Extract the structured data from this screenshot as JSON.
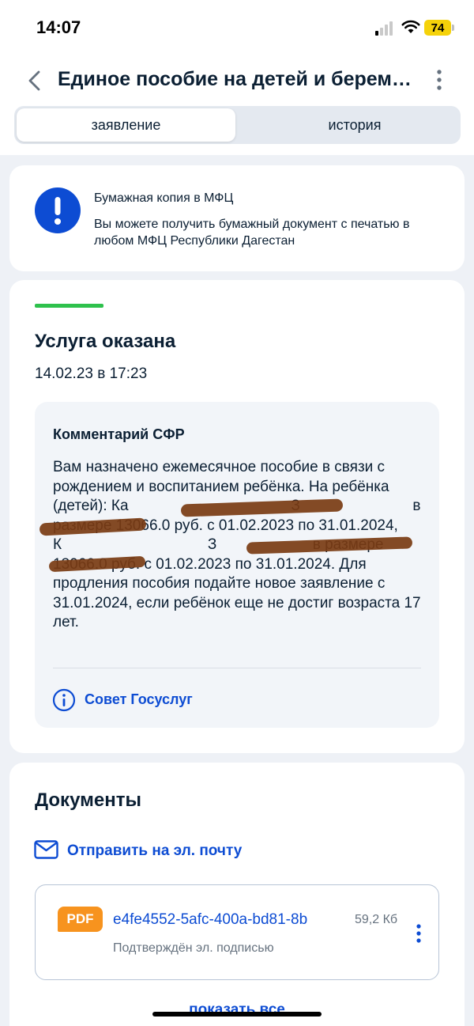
{
  "status_bar": {
    "time": "14:07",
    "battery": "74",
    "battery_color": "#f5d20a"
  },
  "header": {
    "back_icon": "chevron-left-icon",
    "title": "Единое пособие на детей и беременных",
    "more_icon": "vertical-dots-icon"
  },
  "tabs": [
    {
      "label": "заявление",
      "active": true
    },
    {
      "label": "история",
      "active": false
    }
  ],
  "info_card": {
    "icon": "exclamation-icon",
    "title": "Бумажная копия в МФЦ",
    "body": "Вы можете получить бумажный документ с печатью в любом МФЦ Республики Дагестан"
  },
  "status_card": {
    "progress_color": "#2ec14c",
    "title": "Услуга оказана",
    "date": "14.02.23 в 17:23",
    "comment": {
      "title": "Комментарий СФР",
      "text": "Вам назначено ежемесячное пособие в связи с рождением и воспитанием ребёнка. На ребёнка (детей): Ка                                       З                           в размере 13066.0 руб. с 01.02.2023 по 31.01.2024, К                                   З                       в размере 13066.0 руб. с 01.02.2023 по 31.01.2024. Для продления пособия подайте новое заявление с 31.01.2024, если ребёнок еще не достиг возраста 17 лет.",
      "tip_icon": "info-circle-icon",
      "tip_link": "Совет Госуслуг"
    }
  },
  "documents": {
    "title": "Документы",
    "email_icon": "envelope-icon",
    "email_link": "Отправить на эл. почту",
    "file": {
      "badge": "PDF",
      "badge_color": "#f7931e",
      "name": "e4fe4552-5afc-400a-bd81-8b",
      "size": "59,2 Кб",
      "signed": "Подтверждён эл. подписью",
      "more_icon": "vertical-dots-icon"
    },
    "show_all": "показать все"
  },
  "colors": {
    "accent_blue": "#0d4cd3",
    "text_dark": "#0b1f33",
    "page_bg": "#eef1f6"
  }
}
